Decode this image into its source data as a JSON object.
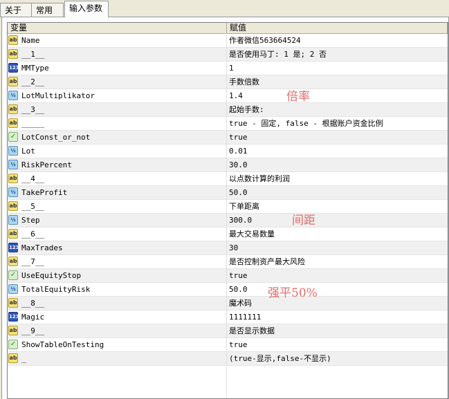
{
  "tabs": [
    {
      "label": "关于"
    },
    {
      "label": "常用"
    },
    {
      "label": "输入参数"
    }
  ],
  "table": {
    "headers": {
      "variable": "变量",
      "value": "赋值"
    },
    "rows": [
      {
        "type": "ab",
        "icon_text": "ab",
        "name": "Name",
        "value": "作者微信563664524"
      },
      {
        "type": "ab",
        "icon_text": "ab",
        "name": "__1__",
        "value": "是否使用马丁: 1 是; 2 否"
      },
      {
        "type": "int",
        "icon_text": "123",
        "name": "MMType",
        "value": "1"
      },
      {
        "type": "ab",
        "icon_text": "ab",
        "name": "__2__",
        "value": "手数倍数"
      },
      {
        "type": "dbl",
        "icon_text": "½",
        "name": "LotMultiplikator",
        "value": "1.4"
      },
      {
        "type": "ab",
        "icon_text": "ab",
        "name": "__3__",
        "value": "起始手数:"
      },
      {
        "type": "ab",
        "icon_text": "ab",
        "name": "_____",
        "value": "true - 固定, false - 根据账户资金比例"
      },
      {
        "type": "bool",
        "icon_text": "✓",
        "name": "LotConst_or_not",
        "value": "true"
      },
      {
        "type": "dbl",
        "icon_text": "½",
        "name": "Lot",
        "value": "0.01"
      },
      {
        "type": "dbl",
        "icon_text": "½",
        "name": "RiskPercent",
        "value": "30.0"
      },
      {
        "type": "ab",
        "icon_text": "ab",
        "name": "__4__",
        "value": "以点数计算的利润"
      },
      {
        "type": "dbl",
        "icon_text": "½",
        "name": "TakeProfit",
        "value": "50.0"
      },
      {
        "type": "ab",
        "icon_text": "ab",
        "name": "__5__",
        "value": "下单距离"
      },
      {
        "type": "dbl",
        "icon_text": "½",
        "name": "Step",
        "value": "300.0"
      },
      {
        "type": "ab",
        "icon_text": "ab",
        "name": "__6__",
        "value": "最大交易数量"
      },
      {
        "type": "int",
        "icon_text": "123",
        "name": "MaxTrades",
        "value": "30"
      },
      {
        "type": "ab",
        "icon_text": "ab",
        "name": "__7__",
        "value": "是否控制资产最大风险"
      },
      {
        "type": "bool",
        "icon_text": "✓",
        "name": "UseEquityStop",
        "value": "true"
      },
      {
        "type": "dbl",
        "icon_text": "½",
        "name": "TotalEquityRisk",
        "value": "50.0"
      },
      {
        "type": "ab",
        "icon_text": "ab",
        "name": "__8__",
        "value": "魔术码"
      },
      {
        "type": "int",
        "icon_text": "123",
        "name": "Magic",
        "value": "1111111"
      },
      {
        "type": "ab",
        "icon_text": "ab",
        "name": "__9__",
        "value": "是否显示数据"
      },
      {
        "type": "bool",
        "icon_text": "✓",
        "name": "ShowTableOnTesting",
        "value": "true"
      },
      {
        "type": "ab",
        "icon_text": "ab",
        "name": "_",
        "value": "(true-显示,false-不显示)"
      }
    ]
  },
  "annotations": {
    "multiplier": "倍率",
    "spacing": "间距",
    "liquidation": "强平50%"
  },
  "colors": {
    "annotation": "#e46a6a"
  }
}
